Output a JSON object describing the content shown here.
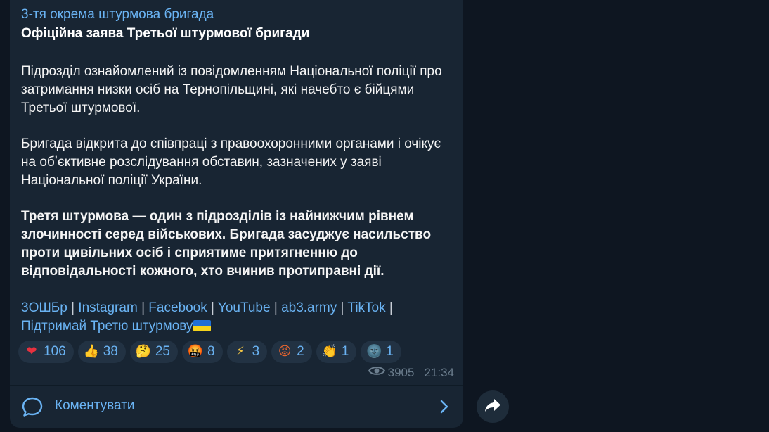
{
  "post": {
    "channel_name": "3-тя окрема штурмова бригада",
    "title": "Офіційна заява Третьої штурмової бригади",
    "paragraph_1": "Підрозділ ознайомлений із повідомленням Національної поліції про затримання низки осіб на Тернопільщині, які начебто є бійцями Третьої штурмової.",
    "paragraph_2": "Бригада відкрита до співпраці з правоохоронними органами і очікує на обʼєктивне розслідування обставин, зазначених у заяві Національної поліції України.",
    "paragraph_3": "Третя штурмова — один з підрозділів із найнижчим рівнем злочинності серед військових. Бригада засуджує насильство проти цивільних осіб і сприятиме притягненню до відповідальності кожного, хто вчинив протиправні дії.",
    "links": {
      "l1": "3ОШБр",
      "l2": "Instagram",
      "l3": "Facebook",
      "l4": "YouTube",
      "l5": "ab3.army",
      "l6": "TikTok",
      "l7": "Підтримай Третю штурмову",
      "separator": "|"
    },
    "reactions": [
      {
        "emoji": "❤",
        "icon": "red-heart-icon",
        "count": "106"
      },
      {
        "emoji": "👍",
        "icon": "thumbs-up-icon",
        "count": "38"
      },
      {
        "emoji": "🤔",
        "icon": "thinking-face-icon",
        "count": "25"
      },
      {
        "emoji": "🤬",
        "icon": "cursing-face-icon",
        "count": "8"
      },
      {
        "emoji": "⚡",
        "icon": "lightning-icon",
        "count": "3"
      },
      {
        "emoji": "😡",
        "icon": "angry-face-icon",
        "count": "2"
      },
      {
        "emoji": "👏",
        "icon": "clapping-hands-icon",
        "count": "1"
      },
      {
        "emoji": "🌚",
        "icon": "new-moon-face-icon",
        "count": "1"
      }
    ],
    "views": "3905",
    "time": "21:34",
    "comment_label": "Коментувати"
  },
  "colors": {
    "background": "#0e1621",
    "bubble": "#182533",
    "link": "#6ab3f3",
    "text": "#f5f5f5",
    "meta": "#6d7f8f",
    "reaction_bg": "#223243"
  }
}
